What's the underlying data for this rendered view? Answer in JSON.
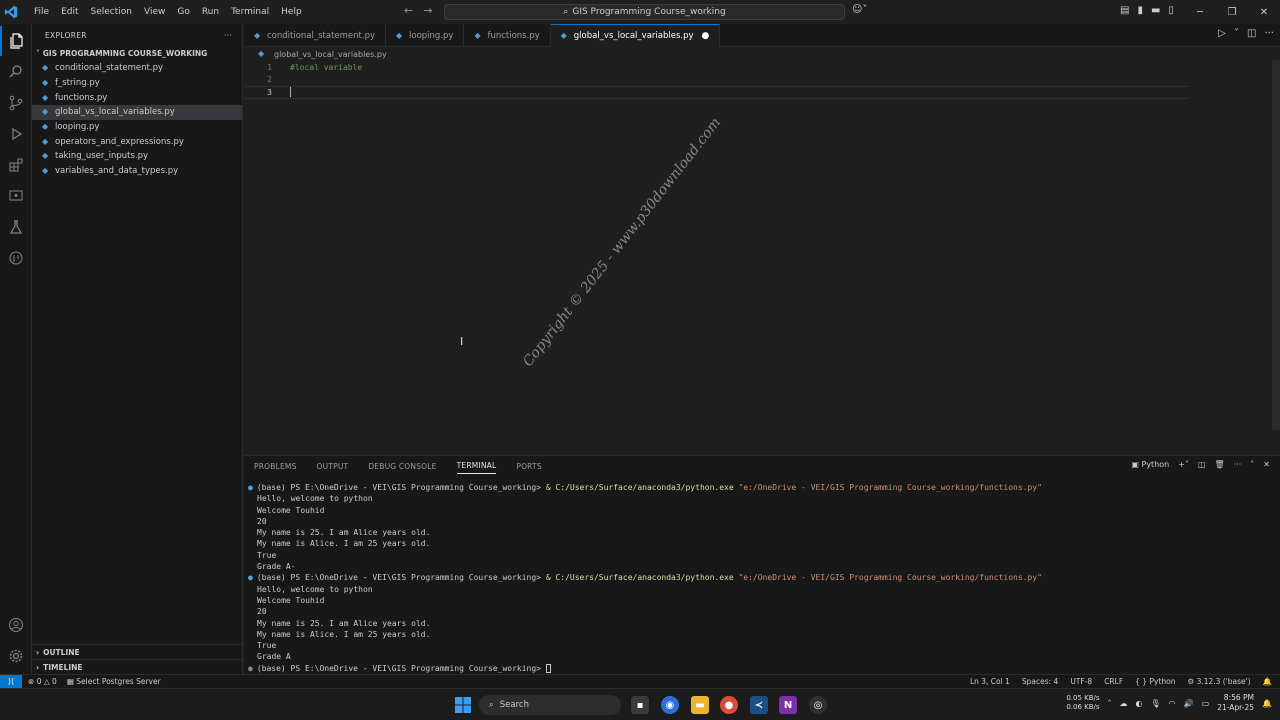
{
  "menu": [
    "File",
    "Edit",
    "Selection",
    "View",
    "Go",
    "Run",
    "Terminal",
    "Help"
  ],
  "command_center": "GIS Programming Course_working",
  "explorer": {
    "title": "EXPLORER",
    "folder": "GIS PROGRAMMING COURSE_WORKING",
    "files": [
      "conditional_statement.py",
      "f_string.py",
      "functions.py",
      "global_vs_local_variables.py",
      "looping.py",
      "operators_and_expressions.py",
      "taking_user_inputs.py",
      "variables_and_data_types.py"
    ],
    "selected_index": 3,
    "outline": "OUTLINE",
    "timeline": "TIMELINE"
  },
  "tabs": [
    "conditional_statement.py",
    "looping.py",
    "functions.py",
    "global_vs_local_variables.py"
  ],
  "active_tab_index": 3,
  "breadcrumb": "global_vs_local_variables.py",
  "editor_lines": [
    {
      "num": "1",
      "code": "#local variable"
    },
    {
      "num": "2",
      "code": ""
    },
    {
      "num": "3",
      "code": ""
    }
  ],
  "watermark": "Copyright © 2025 - www.p30download.com",
  "panel": {
    "tabs": [
      "PROBLEMS",
      "OUTPUT",
      "DEBUG CONSOLE",
      "TERMINAL",
      "PORTS"
    ],
    "active_tab_index": 3,
    "shell_label": "Python"
  },
  "terminal": {
    "prompt": "(base) PS E:\\OneDrive - VEI\\GIS Programming Course_working> ",
    "exe": "& C:/Users/Surface/anaconda3/python.exe",
    "arg": "\"e:/OneDrive - VEI/GIS Programming Course_working/functions.py\"",
    "run1": [
      "Hello, welcome to python",
      "Welcome Touhid",
      "20",
      "My name is 25. I am Alice years old.",
      "My name is Alice. I am 25 years old.",
      "True",
      "Grade A-"
    ],
    "run2": [
      "Hello, welcome to python",
      "Welcome Touhid",
      "20",
      "My name is 25. I am Alice years old.",
      "My name is Alice. I am 25 years old.",
      "True",
      "Grade A"
    ]
  },
  "status": {
    "errors": "0",
    "warnings": "0",
    "postgres": "Select Postgres Server",
    "position": "Ln 3, Col 1",
    "spaces": "Spaces: 4",
    "encoding": "UTF-8",
    "eol": "CRLF",
    "language": "Python",
    "interpreter": "3.12.3 ('base')"
  },
  "taskbar": {
    "search": "Search",
    "net_up": "0.05 KB/s",
    "net_down": "0.06 KB/s",
    "time": "8:56 PM",
    "date": "21-Apr-25"
  }
}
